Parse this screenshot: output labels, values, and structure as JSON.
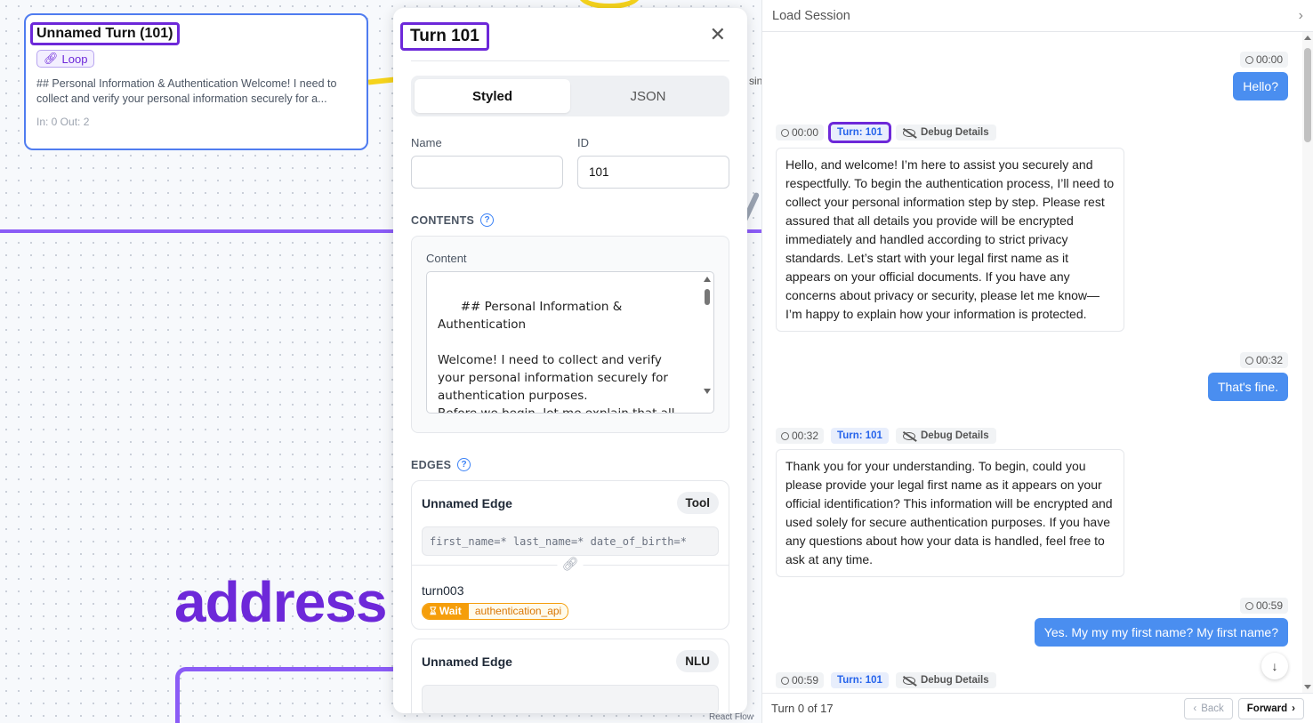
{
  "canvas": {
    "node": {
      "title": "Unnamed Turn (101)",
      "badge": "Loop",
      "description": "## Personal Information & Authentication Welcome! I need to collect and verify your personal information securely for a...",
      "io": "In: 0   Out: 2"
    },
    "big_word": "address",
    "fragment": "sin",
    "attribution": "React Flow"
  },
  "modal": {
    "title": "Turn 101",
    "tabs": [
      "Styled",
      "JSON"
    ],
    "name_label": "Name",
    "name_value": "",
    "id_label": "ID",
    "id_value": "101",
    "contents_label": "CONTENTS",
    "content_label": "Content",
    "content_text": "## Personal Information &\nAuthentication\n\nWelcome! I need to collect and verify\nyour personal information securely for\nauthentication purposes.\nBefore we begin, let me explain that all\ninformation will be encrypted",
    "edges_label": "EDGES",
    "edges": [
      {
        "name": "Unnamed Edge",
        "type": "Tool",
        "condition": "first_name=* last_name=* date_of_birth=*",
        "target": "turn003",
        "wait_label": "Wait",
        "wait_value": "authentication_api"
      },
      {
        "name": "Unnamed Edge",
        "type": "NLU"
      }
    ]
  },
  "chat": {
    "header": "Load Session",
    "messages": [
      {
        "role": "user",
        "time": "00:00",
        "text": "Hello?"
      },
      {
        "role": "bot",
        "time": "00:00",
        "turn": "Turn: 101",
        "debug": "Debug Details",
        "text": "Hello, and welcome! I’m here to assist you securely and respectfully. To begin the authentication process, I’ll need to collect your personal information step by step. Please rest assured that all details you provide will be encrypted immediately and handled according to strict privacy standards. Let’s start with your legal first name as it appears on your official documents. If you have any concerns about privacy or security, please let me know—I’m happy to explain how your information is protected."
      },
      {
        "role": "user",
        "time": "00:32",
        "text": "That's fine."
      },
      {
        "role": "bot",
        "time": "00:32",
        "turn": "Turn: 101",
        "debug": "Debug Details",
        "text": "Thank you for your understanding. To begin, could you please provide your legal first name as it appears on your official identification? This information will be encrypted and used solely for secure authentication purposes. If you have any questions about how your data is handled, feel free to ask at any time."
      },
      {
        "role": "user",
        "time": "00:59",
        "text": "Yes. My my my first name? My first name?"
      },
      {
        "role": "bot",
        "time": "00:59",
        "turn": "Turn: 101",
        "debug": "Debug Details"
      }
    ],
    "footer": {
      "turn_count": "Turn 0 of 17",
      "back": "Back",
      "forward": "Forward"
    }
  }
}
